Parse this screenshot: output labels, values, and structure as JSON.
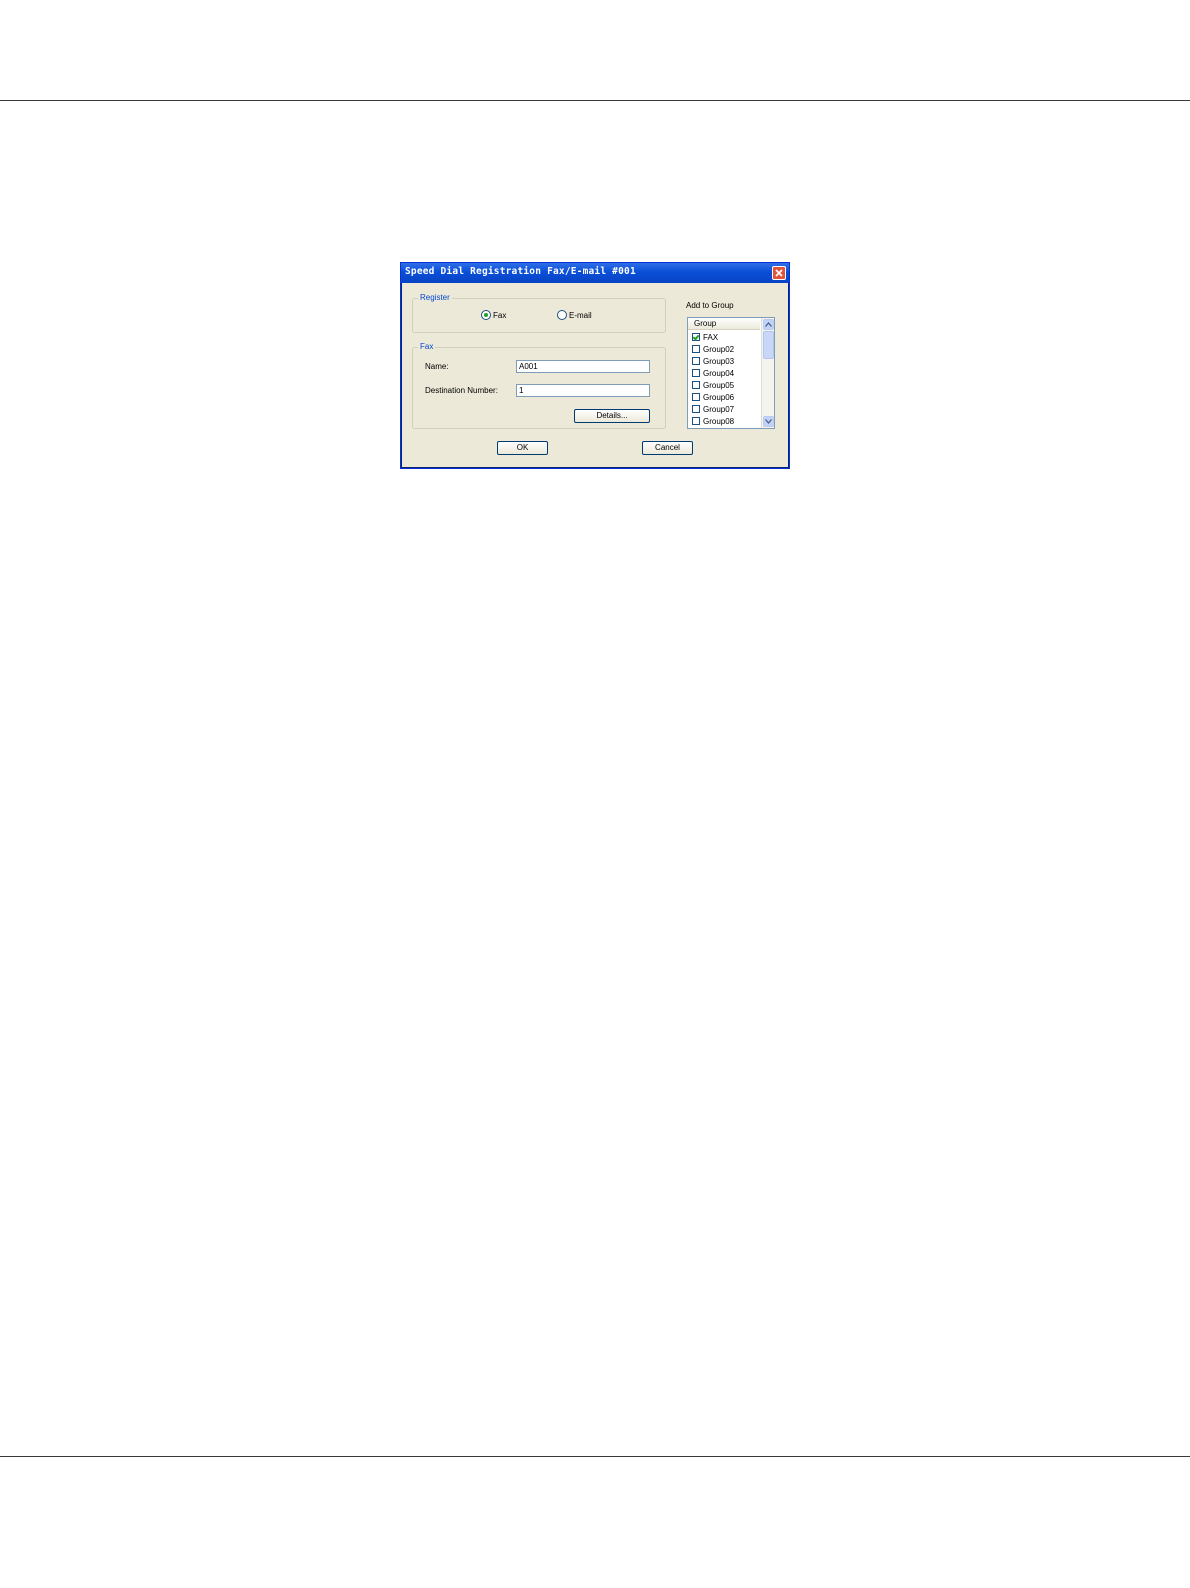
{
  "window": {
    "title": "Speed Dial Registration Fax/E-mail #001"
  },
  "register": {
    "legend": "Register",
    "options": [
      {
        "label": "Fax",
        "checked": true
      },
      {
        "label": "E-mail",
        "checked": false
      }
    ]
  },
  "fax": {
    "legend": "Fax",
    "name_label": "Name:",
    "name_value": "A001",
    "dest_label": "Destination Number:",
    "dest_value": "1",
    "details_label": "Details..."
  },
  "add_to_group": {
    "label": "Add to Group",
    "column_header": "Group",
    "items": [
      {
        "label": "FAX",
        "checked": true
      },
      {
        "label": "Group02",
        "checked": false
      },
      {
        "label": "Group03",
        "checked": false
      },
      {
        "label": "Group04",
        "checked": false
      },
      {
        "label": "Group05",
        "checked": false
      },
      {
        "label": "Group06",
        "checked": false
      },
      {
        "label": "Group07",
        "checked": false
      },
      {
        "label": "Group08",
        "checked": false
      }
    ]
  },
  "buttons": {
    "ok": "OK",
    "cancel": "Cancel"
  },
  "colors": {
    "title_bar": "#0a4fd8",
    "legend_text": "#0046d5",
    "dialog_bg": "#ece9d8",
    "close_button": "#e1543a"
  }
}
